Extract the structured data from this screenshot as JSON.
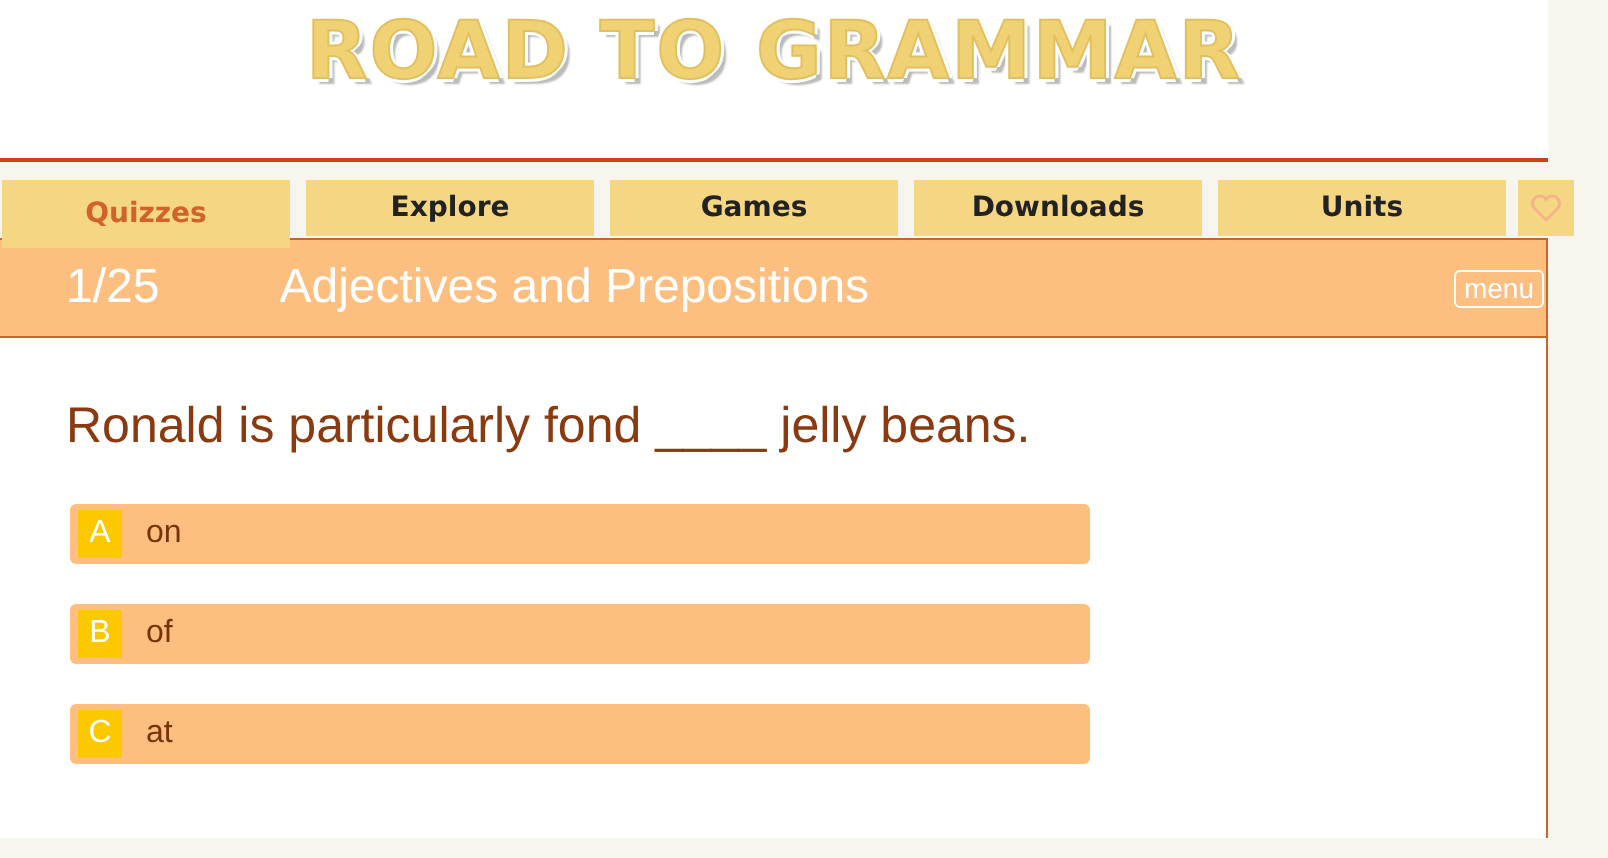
{
  "logo": "ROAD TO GRAMMAR",
  "nav": [
    {
      "label": "Quizzes",
      "selected": true
    },
    {
      "label": "Explore",
      "selected": false
    },
    {
      "label": "Games",
      "selected": false
    },
    {
      "label": "Downloads",
      "selected": false
    },
    {
      "label": "Units",
      "selected": false
    }
  ],
  "quiz": {
    "counter": "1/25",
    "title": "Adjectives and Prepositions",
    "menu": "menu",
    "question": "Ronald is particularly fond ____ jelly beans.",
    "options": [
      {
        "letter": "A",
        "text": "on"
      },
      {
        "letter": "B",
        "text": "of"
      },
      {
        "letter": "C",
        "text": "at"
      }
    ]
  }
}
